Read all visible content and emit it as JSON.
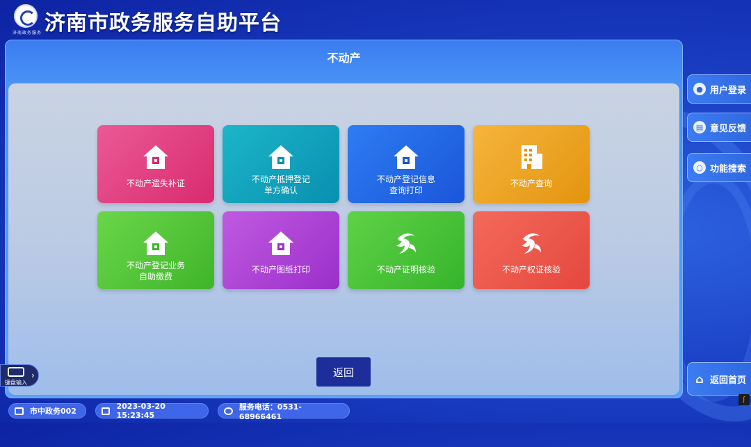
{
  "header": {
    "title": "济南市政务服务自助平台",
    "logo_text": "济南政务服务"
  },
  "panel": {
    "title": "不动产"
  },
  "tiles": [
    {
      "label": "不动产遗失补证",
      "icon": "house-icon",
      "color_from": "#ea5a95",
      "color_to": "#d92a70"
    },
    {
      "label": "不动产抵押登记\n单方确认",
      "icon": "house-icon",
      "color_from": "#1bb6c8",
      "color_to": "#0a8fb0"
    },
    {
      "label": "不动产登记信息\n查询打印",
      "icon": "house-icon",
      "color_from": "#2d7df2",
      "color_to": "#1b55d9"
    },
    {
      "label": "不动产查询",
      "icon": "building-icon",
      "color_from": "#f5b53d",
      "color_to": "#e4940e"
    },
    {
      "label": "不动产登记业务\n自助缴费",
      "icon": "house-icon",
      "color_from": "#6bd64a",
      "color_to": "#3fb52a"
    },
    {
      "label": "不动产图纸打印",
      "icon": "house-icon",
      "color_from": "#c05ae0",
      "color_to": "#9b2fca"
    },
    {
      "label": "不动产证明核验",
      "icon": "swirl-logo-icon",
      "color_from": "#5fd247",
      "color_to": "#36b42b"
    },
    {
      "label": "不动产权证核验",
      "icon": "swirl-logo-icon",
      "color_from": "#f36a5a",
      "color_to": "#e5473f"
    }
  ],
  "back_button": {
    "label": "返回"
  },
  "sidebar": {
    "items": [
      {
        "label": "用户登录",
        "icon": "user-icon"
      },
      {
        "label": "意见反馈",
        "icon": "feedback-icon"
      },
      {
        "label": "功能搜索",
        "icon": "search-icon"
      }
    ],
    "home": {
      "label": "返回首页",
      "icon": "home-icon"
    }
  },
  "keyboard": {
    "label": "键盘输入"
  },
  "footer": {
    "terminal": "市中政务002",
    "datetime": "2023-03-20 15:23:45",
    "phone": "服务电话：0531-68966461"
  }
}
